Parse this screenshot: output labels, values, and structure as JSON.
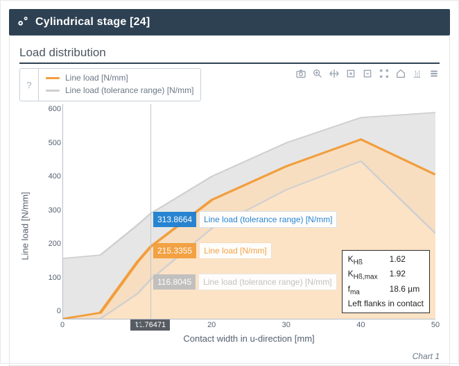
{
  "header": {
    "title": "Cylindrical stage [24]"
  },
  "card": {
    "title": "Load distribution",
    "caption": "Chart 1"
  },
  "legend": {
    "btn_label": "?",
    "items": [
      {
        "swatch": "#f29e3d",
        "label": "Line load [N/mm]"
      },
      {
        "swatch": "#cfcfcf",
        "label": "Line load  (tolerance range) [N/mm]"
      }
    ]
  },
  "axes": {
    "xlabel": "Contact width in u-direction [mm]",
    "ylabel": "Line load [N/mm]",
    "xticks": [
      0,
      10,
      20,
      30,
      40,
      50
    ],
    "yticks": [
      0,
      100,
      200,
      300,
      400,
      500,
      600
    ],
    "xlim": [
      0,
      50
    ],
    "ylim": [
      0,
      640
    ]
  },
  "hover": {
    "x_label": "11.76471",
    "vline_x": 11.76471,
    "upper": {
      "value": "313.8664",
      "label": "Line load  (tolerance range) [N/mm]"
    },
    "mid": {
      "value": "215.3355",
      "label": "Line load [N/mm]"
    },
    "lower": {
      "value": "116.8045",
      "label": "Line load  (tolerance range) [N/mm]"
    }
  },
  "info": {
    "KHb_label": "K",
    "KHb_sub": "Hß",
    "KHb_val": "1.62",
    "KHbmax_label": "K",
    "KHbmax_sub": "Hß,max",
    "KHbmax_val": "1.92",
    "fma_label": "f",
    "fma_sub": "ma",
    "fma_val": "18.6 µm",
    "note": "Left flanks in contact"
  },
  "colors": {
    "line": "#f29e3d",
    "line_fill": "#fbdcb7",
    "tol": "#d8d8d8",
    "tol_line": "#d0d0d0"
  },
  "chart_data": {
    "type": "area",
    "title": "Load distribution",
    "xlabel": "Contact width in u-direction [mm]",
    "ylabel": "Line load [N/mm]",
    "xlim": [
      0,
      50
    ],
    "ylim": [
      0,
      640
    ],
    "x": [
      0,
      5,
      10,
      11.76,
      20,
      30,
      40,
      50
    ],
    "series": [
      {
        "name": "Line load [N/mm]",
        "values": [
          0,
          18,
          170,
          215,
          355,
          455,
          535,
          430
        ]
      },
      {
        "name": "Line load (tolerance range) upper [N/mm]",
        "values": [
          180,
          190,
          280,
          314,
          425,
          525,
          600,
          615
        ]
      },
      {
        "name": "Line load (tolerance range) lower [N/mm]",
        "values": [
          0,
          0,
          75,
          117,
          270,
          385,
          470,
          255
        ]
      }
    ],
    "annotations": [
      {
        "x": 11.76,
        "text": "313.8664",
        "series": "upper"
      },
      {
        "x": 11.76,
        "text": "215.3355",
        "series": "line"
      },
      {
        "x": 11.76,
        "text": "116.8045",
        "series": "lower"
      }
    ]
  }
}
